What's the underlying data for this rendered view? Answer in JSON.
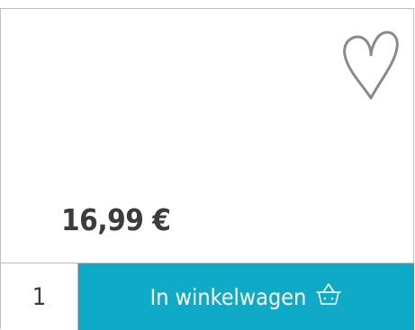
{
  "product": {
    "price": "16,99 €"
  },
  "purchase": {
    "quantity": "1",
    "add_to_cart_label": "In winkelwagen"
  },
  "icons": {
    "wishlist": "heart-outline-icon",
    "cart": "shopping-basket-icon"
  },
  "colors": {
    "accent": "#10aac9",
    "border": "#bdbdbd",
    "text": "#3c3c3c",
    "icon": "#8a8a8a"
  }
}
